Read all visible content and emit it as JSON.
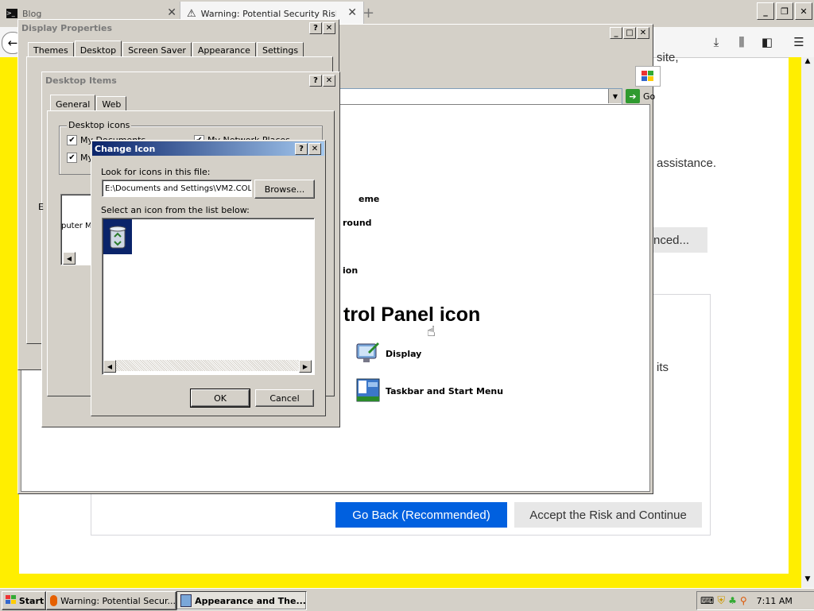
{
  "browser": {
    "tabs": [
      {
        "title": "Blog"
      },
      {
        "title": "Warning: Potential Security Risk A"
      }
    ],
    "new_tab_symbol": "+"
  },
  "page": {
    "fragments": {
      "top_right": "site,",
      "assistance": "assistance.",
      "advanced": "nced...",
      "its": "its"
    },
    "buttons": {
      "go_back": "Go Back (Recommended)",
      "accept": "Accept the Risk and Continue"
    }
  },
  "explorer": {
    "go_label": "Go",
    "task_fragments": [
      "eme",
      "round",
      "ion"
    ],
    "heading": "trol Panel icon",
    "links": [
      {
        "label": "Display",
        "icon": "display-icon"
      },
      {
        "label": "Taskbar and Start Menu",
        "icon": "taskbar-icon"
      }
    ]
  },
  "display_properties": {
    "title": "Display Properties",
    "tabs": [
      "Themes",
      "Desktop",
      "Screen Saver",
      "Appearance",
      "Settings"
    ],
    "selected_tab": "Desktop"
  },
  "desktop_items": {
    "title": "Desktop Items",
    "tabs": [
      "General",
      "Web"
    ],
    "selected_tab": "General",
    "group_label": "Desktop icons",
    "checkboxes": [
      {
        "label": "My Documents",
        "checked": true
      },
      {
        "label": "My Network Places",
        "checked": true
      },
      {
        "label": "My",
        "checked": true
      }
    ],
    "icon_fragments": [
      "puter",
      "M"
    ],
    "side_letter": "E"
  },
  "change_icon": {
    "title": "Change Icon",
    "file_label": "Look for icons in this file:",
    "file_value": "E:\\Documents and Settings\\VM2.COL",
    "browse": "Browse...",
    "list_label": "Select an icon from the list below:",
    "ok": "OK",
    "cancel": "Cancel"
  },
  "taskbar": {
    "start": "Start",
    "items": [
      {
        "label": "Warning: Potential Secur...",
        "active": false
      },
      {
        "label": "Appearance and The...",
        "active": true
      }
    ],
    "clock": "7:11 AM"
  }
}
